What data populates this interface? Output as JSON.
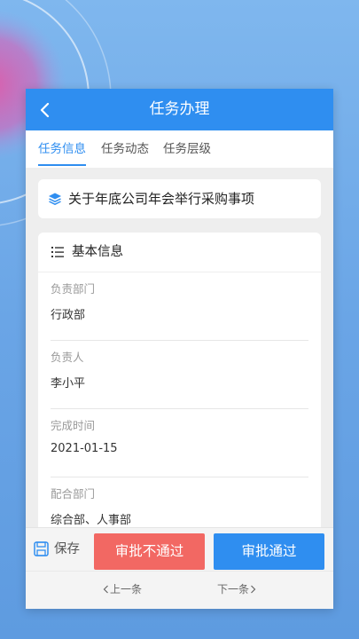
{
  "header": {
    "title": "任务办理"
  },
  "tabs": [
    {
      "label": "任务信息"
    },
    {
      "label": "任务动态"
    },
    {
      "label": "任务层级"
    }
  ],
  "topic": {
    "title": "关于年底公司年会举行采购事项"
  },
  "basic_info": {
    "title": "基本信息",
    "fields": [
      {
        "label": "负责部门",
        "value": "行政部"
      },
      {
        "label": "负责人",
        "value": "李小平"
      },
      {
        "label": "完成时间",
        "value": "2021-01-15"
      },
      {
        "label": "配合部门",
        "value": "综合部、人事部"
      }
    ]
  },
  "actions": {
    "save_label": "保存",
    "reject_label": "审批不通过",
    "approve_label": "审批通过"
  },
  "pager": {
    "prev_label": "上一条",
    "next_label": "下一条"
  },
  "colors": {
    "primary": "#2f8ef0",
    "reject": "#f26863",
    "background": "#6aa5e6"
  }
}
